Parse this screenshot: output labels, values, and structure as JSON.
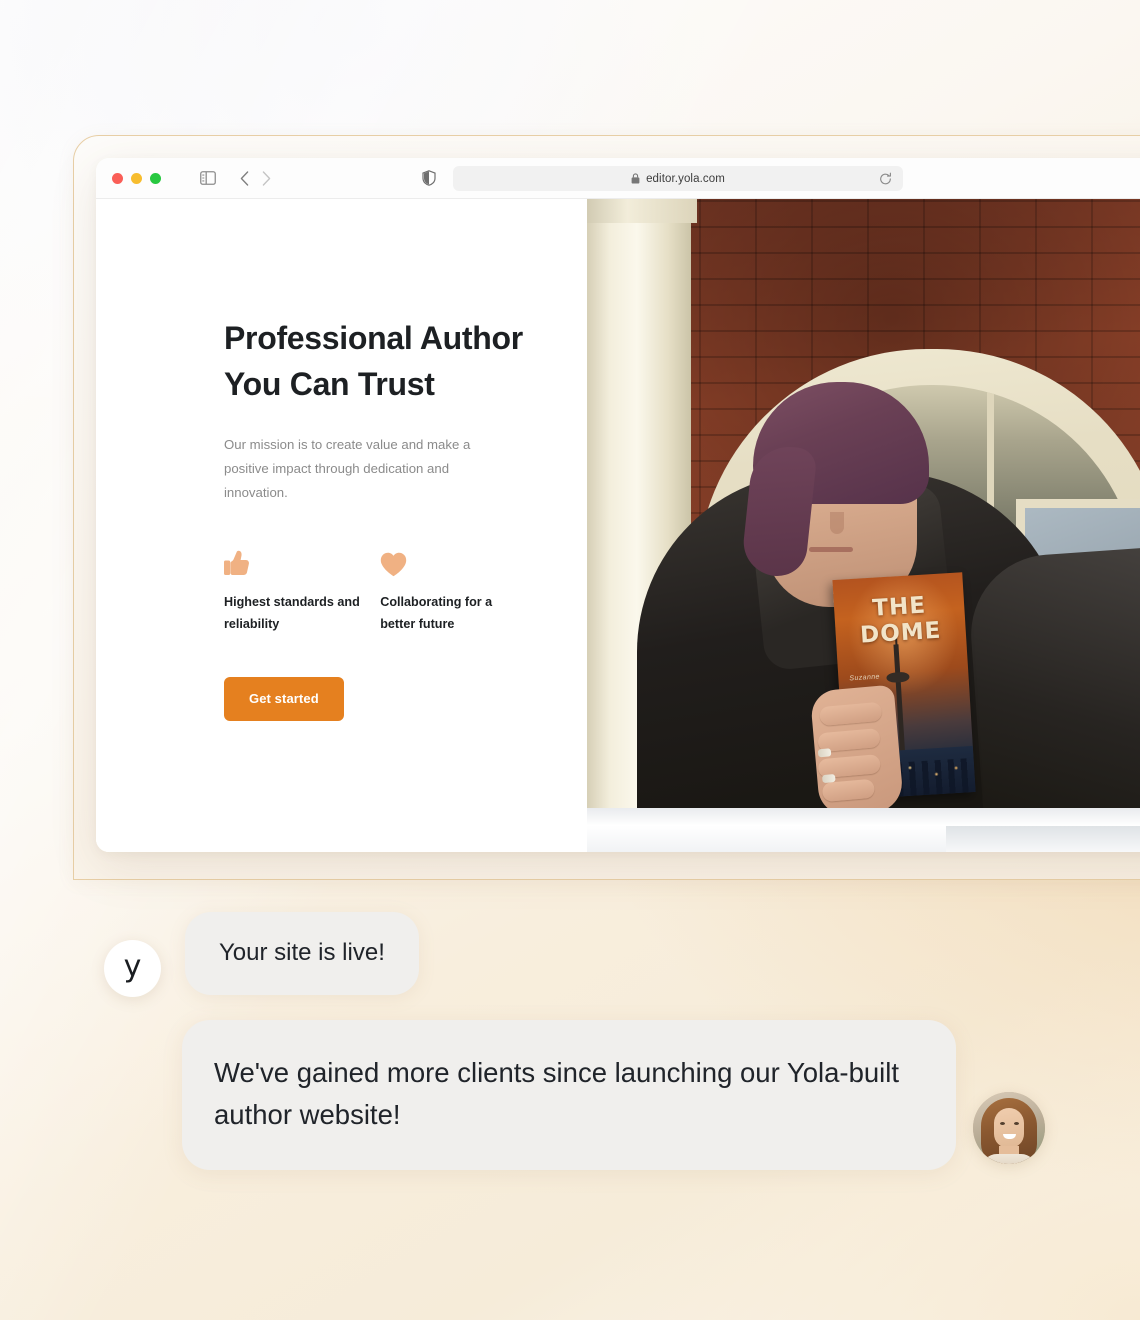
{
  "browser": {
    "traffic_lights": [
      "close",
      "minimize",
      "maximize"
    ],
    "url": "editor.yola.com",
    "icons": {
      "sidebar": "sidebar-toggle-icon",
      "back": "chevron-left-icon",
      "forward": "chevron-right-icon",
      "shield": "privacy-shield-icon",
      "lock": "lock-icon",
      "reload": "reload-icon"
    }
  },
  "hero": {
    "title": "Professional Author You Can Trust",
    "subtitle": "Our mission is to create value and make a positive impact through dedication and innovation.",
    "features": [
      {
        "icon": "thumbs-up-icon",
        "label": "Highest standards and reliability"
      },
      {
        "icon": "heart-icon",
        "label": "Collaborating for a better future"
      }
    ],
    "cta_label": "Get started",
    "photo": {
      "alt": "Author holding her book on a brick porch",
      "book_title": "THE DOME",
      "book_author": "Suzanne"
    }
  },
  "chat": {
    "messages": [
      {
        "avatar_type": "yola-logo",
        "avatar_label": "y",
        "text": "Your site is live!"
      },
      {
        "avatar_type": "client-photo",
        "text": "We've gained more clients since launching our Yola-built author website!"
      }
    ]
  },
  "colors": {
    "accent_orange": "#e5801f",
    "feature_icon": "#f0b183",
    "bubble_bg": "#f0efed",
    "text_dark": "#1d2023",
    "text_muted": "#8b8b8b",
    "page_bg_cream": "#f6ecd9",
    "frame_border": "#e8cfa6"
  }
}
